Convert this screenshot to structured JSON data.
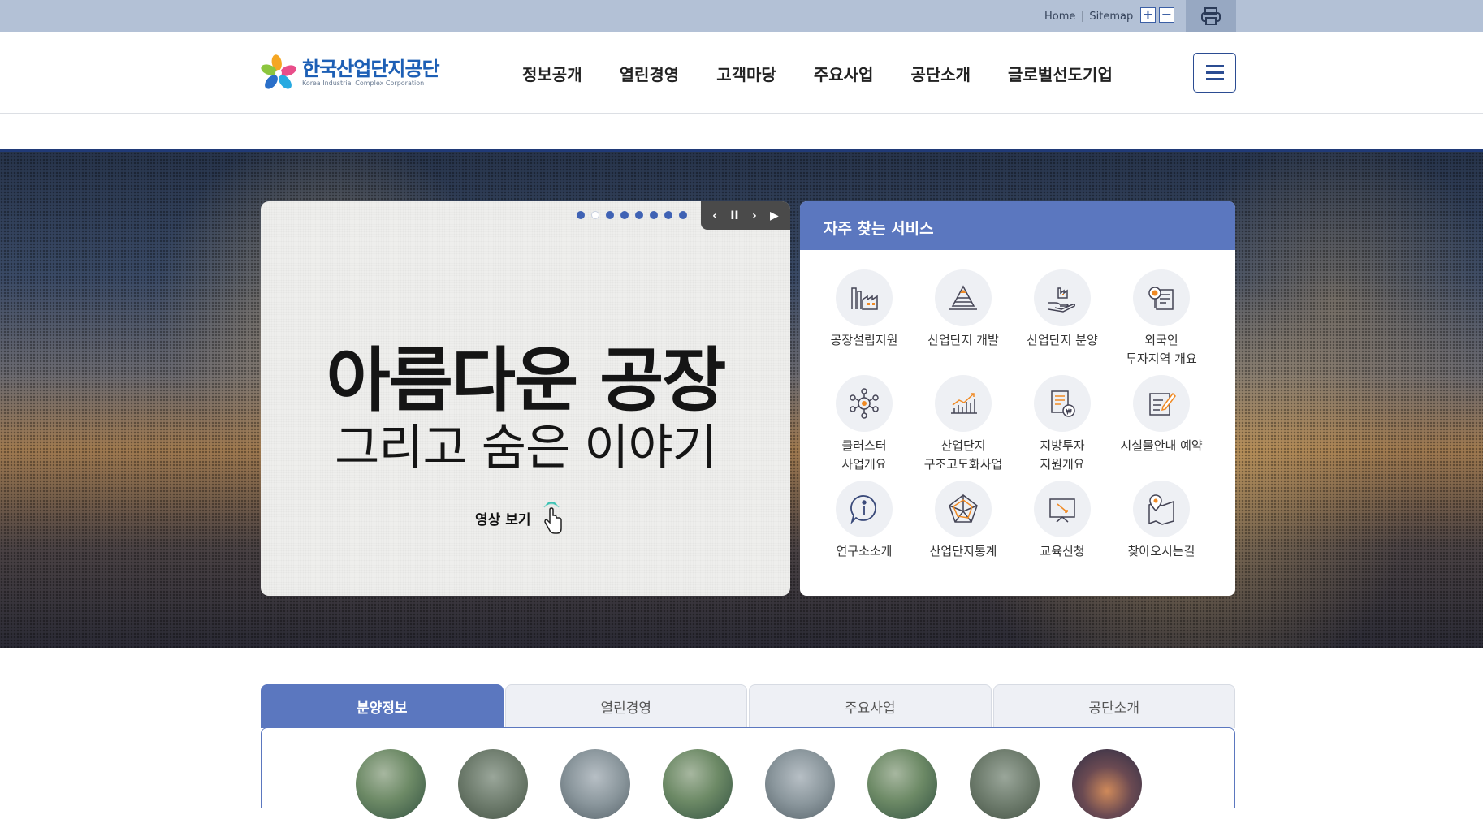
{
  "util": {
    "home": "Home",
    "sitemap": "Sitemap",
    "zoom_in": "+",
    "zoom_out": "−",
    "print_icon": "printer-icon"
  },
  "logo": {
    "name_ko": "한국산업단지공단",
    "name_en": "Korea Industrial Complex Corporation"
  },
  "gnb": [
    "정보공개",
    "열린경영",
    "고객마당",
    "주요사업",
    "공단소개",
    "글로벌선도기업"
  ],
  "visual": {
    "title": "아름다운 공장",
    "subtitle": "그리고 숨은 이야기",
    "link": "영상 보기",
    "slide_count": 8,
    "active_slide": 2,
    "controls": {
      "prev": "‹",
      "pause": "II",
      "next": "›",
      "play": "▶"
    }
  },
  "services": {
    "title": "자주 찾는 서비스",
    "items": [
      {
        "label": "공장설립지원",
        "icon": "factory-icon"
      },
      {
        "label": "산업단지 개발",
        "icon": "development-icon"
      },
      {
        "label": "산업단지 분양",
        "icon": "hand-factory-icon"
      },
      {
        "label": "외국인\n투자지역 개요",
        "icon": "foreign-investment-icon"
      },
      {
        "label": "클러스터\n사업개요",
        "icon": "cluster-icon"
      },
      {
        "label": "산업단지\n구조고도화사업",
        "icon": "growth-chart-icon"
      },
      {
        "label": "지방투자\n지원개요",
        "icon": "coin-support-icon"
      },
      {
        "label": "시설물안내 예약",
        "icon": "edit-document-icon"
      },
      {
        "label": "연구소소개",
        "icon": "info-icon"
      },
      {
        "label": "산업단지통계",
        "icon": "radar-chart-icon"
      },
      {
        "label": "교육신청",
        "icon": "education-icon"
      },
      {
        "label": "찾아오시는길",
        "icon": "map-pin-icon"
      }
    ]
  },
  "tabs": [
    {
      "label": "분양정보",
      "active": true
    },
    {
      "label": "열린경영",
      "active": false
    },
    {
      "label": "주요사업",
      "active": false
    },
    {
      "label": "공단소개",
      "active": false
    }
  ],
  "colors": {
    "primary": "#5b77bf",
    "navy": "#2b4c92",
    "utilbar": "#b3c1d6"
  }
}
